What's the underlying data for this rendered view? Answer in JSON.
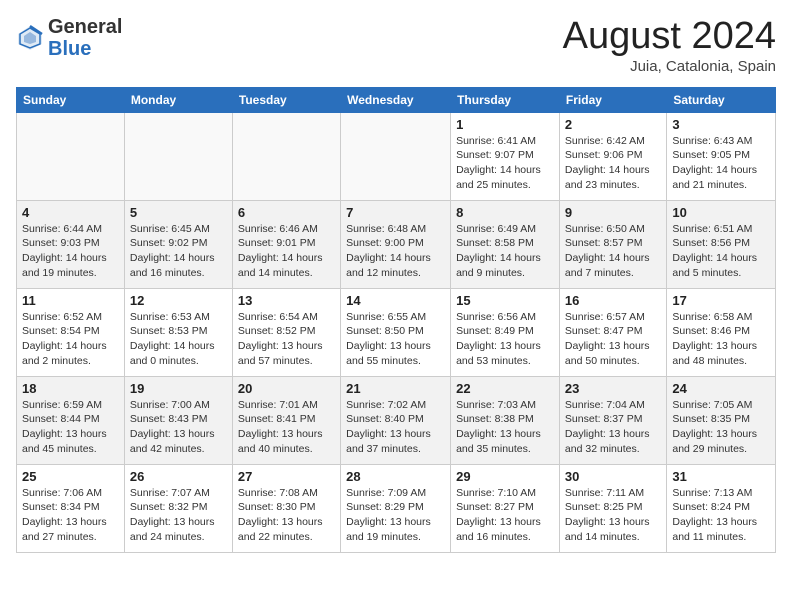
{
  "header": {
    "logo_general": "General",
    "logo_blue": "Blue",
    "month_title": "August 2024",
    "location": "Juia, Catalonia, Spain"
  },
  "weekdays": [
    "Sunday",
    "Monday",
    "Tuesday",
    "Wednesday",
    "Thursday",
    "Friday",
    "Saturday"
  ],
  "weeks": [
    [
      {
        "day": "",
        "info": ""
      },
      {
        "day": "",
        "info": ""
      },
      {
        "day": "",
        "info": ""
      },
      {
        "day": "",
        "info": ""
      },
      {
        "day": "1",
        "info": "Sunrise: 6:41 AM\nSunset: 9:07 PM\nDaylight: 14 hours\nand 25 minutes."
      },
      {
        "day": "2",
        "info": "Sunrise: 6:42 AM\nSunset: 9:06 PM\nDaylight: 14 hours\nand 23 minutes."
      },
      {
        "day": "3",
        "info": "Sunrise: 6:43 AM\nSunset: 9:05 PM\nDaylight: 14 hours\nand 21 minutes."
      }
    ],
    [
      {
        "day": "4",
        "info": "Sunrise: 6:44 AM\nSunset: 9:03 PM\nDaylight: 14 hours\nand 19 minutes."
      },
      {
        "day": "5",
        "info": "Sunrise: 6:45 AM\nSunset: 9:02 PM\nDaylight: 14 hours\nand 16 minutes."
      },
      {
        "day": "6",
        "info": "Sunrise: 6:46 AM\nSunset: 9:01 PM\nDaylight: 14 hours\nand 14 minutes."
      },
      {
        "day": "7",
        "info": "Sunrise: 6:48 AM\nSunset: 9:00 PM\nDaylight: 14 hours\nand 12 minutes."
      },
      {
        "day": "8",
        "info": "Sunrise: 6:49 AM\nSunset: 8:58 PM\nDaylight: 14 hours\nand 9 minutes."
      },
      {
        "day": "9",
        "info": "Sunrise: 6:50 AM\nSunset: 8:57 PM\nDaylight: 14 hours\nand 7 minutes."
      },
      {
        "day": "10",
        "info": "Sunrise: 6:51 AM\nSunset: 8:56 PM\nDaylight: 14 hours\nand 5 minutes."
      }
    ],
    [
      {
        "day": "11",
        "info": "Sunrise: 6:52 AM\nSunset: 8:54 PM\nDaylight: 14 hours\nand 2 minutes."
      },
      {
        "day": "12",
        "info": "Sunrise: 6:53 AM\nSunset: 8:53 PM\nDaylight: 14 hours\nand 0 minutes."
      },
      {
        "day": "13",
        "info": "Sunrise: 6:54 AM\nSunset: 8:52 PM\nDaylight: 13 hours\nand 57 minutes."
      },
      {
        "day": "14",
        "info": "Sunrise: 6:55 AM\nSunset: 8:50 PM\nDaylight: 13 hours\nand 55 minutes."
      },
      {
        "day": "15",
        "info": "Sunrise: 6:56 AM\nSunset: 8:49 PM\nDaylight: 13 hours\nand 53 minutes."
      },
      {
        "day": "16",
        "info": "Sunrise: 6:57 AM\nSunset: 8:47 PM\nDaylight: 13 hours\nand 50 minutes."
      },
      {
        "day": "17",
        "info": "Sunrise: 6:58 AM\nSunset: 8:46 PM\nDaylight: 13 hours\nand 48 minutes."
      }
    ],
    [
      {
        "day": "18",
        "info": "Sunrise: 6:59 AM\nSunset: 8:44 PM\nDaylight: 13 hours\nand 45 minutes."
      },
      {
        "day": "19",
        "info": "Sunrise: 7:00 AM\nSunset: 8:43 PM\nDaylight: 13 hours\nand 42 minutes."
      },
      {
        "day": "20",
        "info": "Sunrise: 7:01 AM\nSunset: 8:41 PM\nDaylight: 13 hours\nand 40 minutes."
      },
      {
        "day": "21",
        "info": "Sunrise: 7:02 AM\nSunset: 8:40 PM\nDaylight: 13 hours\nand 37 minutes."
      },
      {
        "day": "22",
        "info": "Sunrise: 7:03 AM\nSunset: 8:38 PM\nDaylight: 13 hours\nand 35 minutes."
      },
      {
        "day": "23",
        "info": "Sunrise: 7:04 AM\nSunset: 8:37 PM\nDaylight: 13 hours\nand 32 minutes."
      },
      {
        "day": "24",
        "info": "Sunrise: 7:05 AM\nSunset: 8:35 PM\nDaylight: 13 hours\nand 29 minutes."
      }
    ],
    [
      {
        "day": "25",
        "info": "Sunrise: 7:06 AM\nSunset: 8:34 PM\nDaylight: 13 hours\nand 27 minutes."
      },
      {
        "day": "26",
        "info": "Sunrise: 7:07 AM\nSunset: 8:32 PM\nDaylight: 13 hours\nand 24 minutes."
      },
      {
        "day": "27",
        "info": "Sunrise: 7:08 AM\nSunset: 8:30 PM\nDaylight: 13 hours\nand 22 minutes."
      },
      {
        "day": "28",
        "info": "Sunrise: 7:09 AM\nSunset: 8:29 PM\nDaylight: 13 hours\nand 19 minutes."
      },
      {
        "day": "29",
        "info": "Sunrise: 7:10 AM\nSunset: 8:27 PM\nDaylight: 13 hours\nand 16 minutes."
      },
      {
        "day": "30",
        "info": "Sunrise: 7:11 AM\nSunset: 8:25 PM\nDaylight: 13 hours\nand 14 minutes."
      },
      {
        "day": "31",
        "info": "Sunrise: 7:13 AM\nSunset: 8:24 PM\nDaylight: 13 hours\nand 11 minutes."
      }
    ]
  ]
}
